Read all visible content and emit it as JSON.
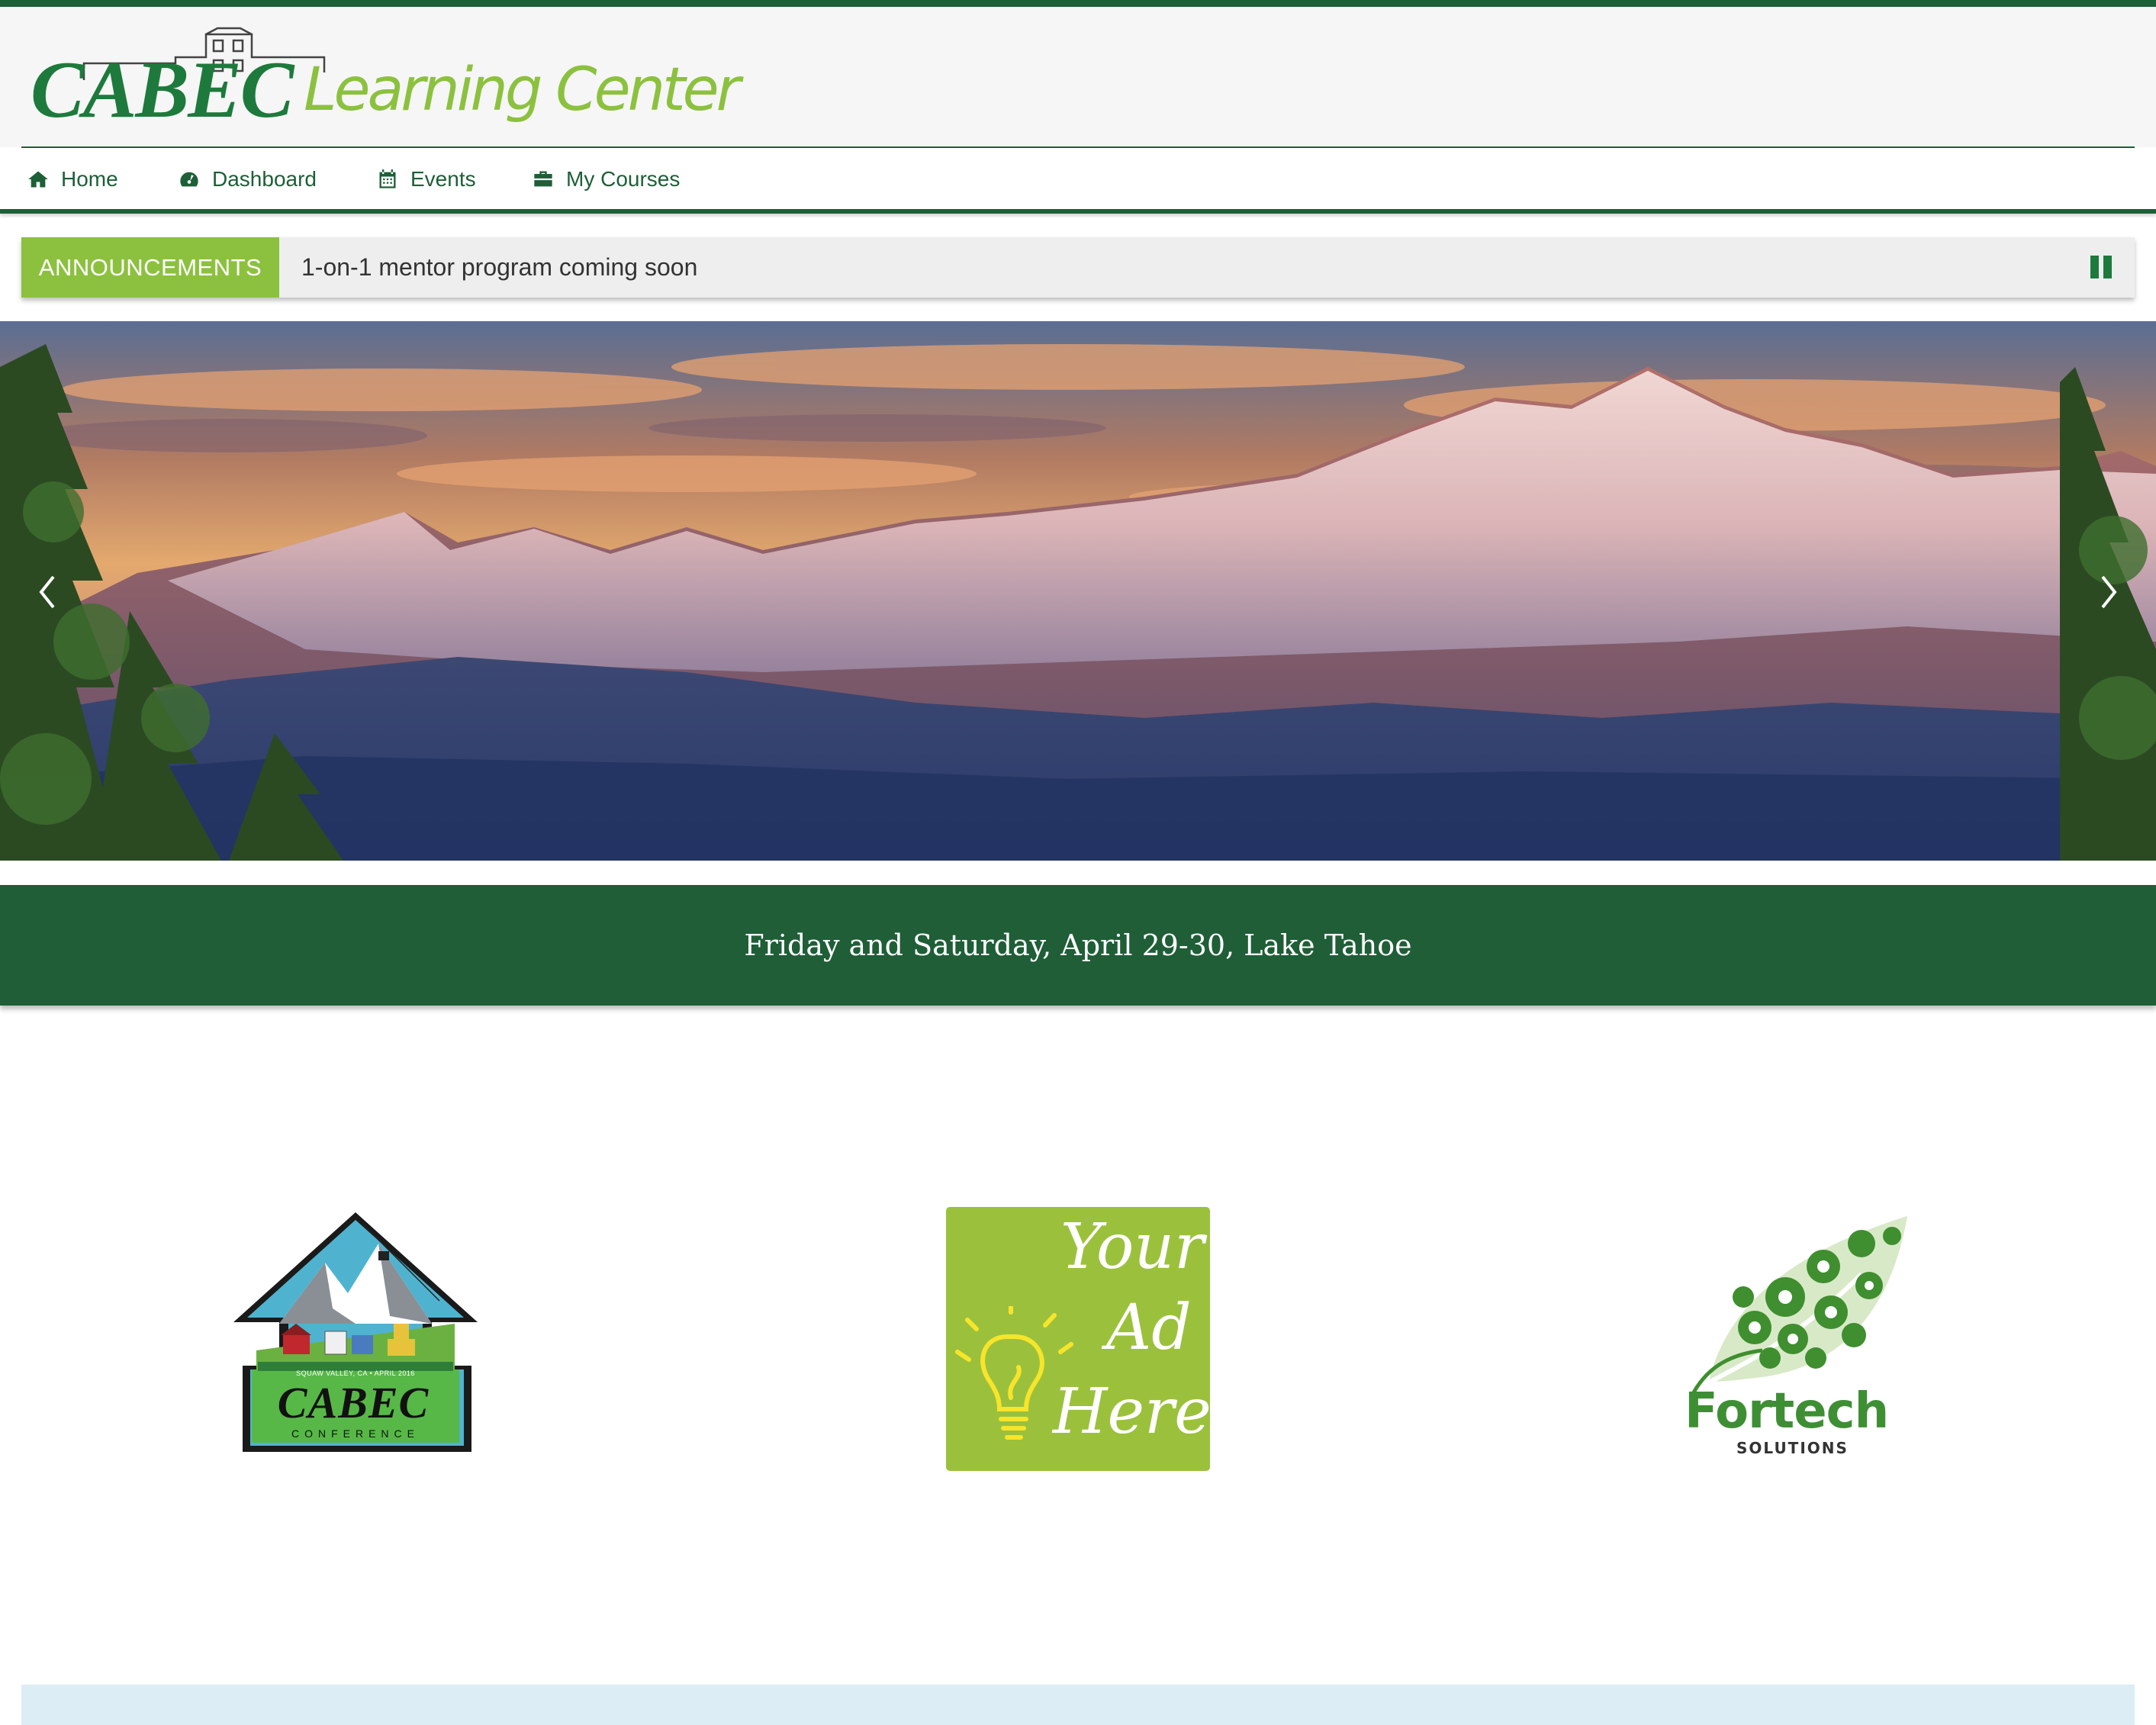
{
  "header": {
    "logo_cabec": "CABEC",
    "logo_subtitle": "Learning Center"
  },
  "nav": {
    "items": [
      {
        "label": "Home",
        "icon": "home-icon"
      },
      {
        "label": "Dashboard",
        "icon": "dashboard-icon"
      },
      {
        "label": "Events",
        "icon": "calendar-icon"
      },
      {
        "label": "My Courses",
        "icon": "briefcase-icon"
      }
    ]
  },
  "announcements": {
    "label": "ANNOUNCEMENTS",
    "text": "1-on-1 mentor program coming soon"
  },
  "event": {
    "text": "Friday and Saturday, April 29-30, Lake Tahoe"
  },
  "sponsors": {
    "cabec_conference": {
      "title": "CABEC",
      "subtitle": "CONFERENCE",
      "ribbon": "SQUAW VALLEY, CA • APRIL 2016"
    },
    "your_ad": {
      "line1": "Your",
      "line2": "Ad",
      "line3": "Here!"
    },
    "fortech": {
      "name": "Fortech",
      "subtitle": "SOLUTIONS"
    }
  },
  "colors": {
    "brand_dark_green": "#1d5f37",
    "brand_light_green": "#8cc13f",
    "banner_green": "#1f5e37",
    "ad_green": "#9bc13c",
    "panel_blue": "#dcedf6"
  }
}
